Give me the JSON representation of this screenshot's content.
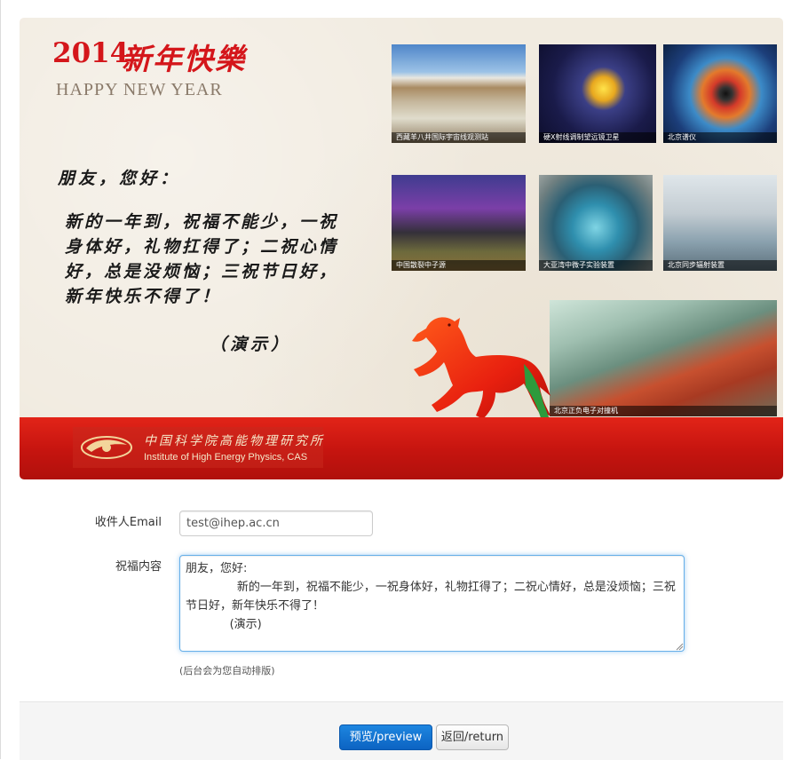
{
  "card": {
    "year": "2014",
    "title_cn": "新年快樂",
    "title_en": "HAPPY NEW YEAR",
    "greeting": "朋友，您好：",
    "body": "新的一年到，祝福不能少，一祝身体好，礼物扛得了；二祝心情好，总是没烦恼；三祝节日好，新年快乐不得了！",
    "signature": "（演示）",
    "photos": [
      {
        "caption": "西藏羊八井国际宇宙线观测站"
      },
      {
        "caption": "硬X射线调制望远镜卫星"
      },
      {
        "caption": "北京谱仪"
      },
      {
        "caption": "中国散裂中子源"
      },
      {
        "caption": "大亚湾中微子实验装置"
      },
      {
        "caption": "北京同步辐射装置"
      },
      {
        "caption": "北京正负电子对撞机"
      }
    ],
    "logo_cn": "中国科学院高能物理研究所",
    "logo_en": "Institute of High Energy Physics, CAS"
  },
  "form": {
    "email_label": "收件人Email",
    "email_value": "test@ihep.ac.cn",
    "content_label": "祝福内容",
    "content_value": "朋友，您好:\n              新的一年到，祝福不能少，一祝身体好，礼物扛得了；二祝心情好，总是没烦恼；三祝节日好，新年快乐不得了！\n            (演示)",
    "hint": "(后台会为您自动排版)"
  },
  "buttons": {
    "preview": "预览/preview",
    "return": "返回/return"
  },
  "colors": {
    "accent_red": "#d4161b",
    "primary_blue": "#0c63c2"
  }
}
